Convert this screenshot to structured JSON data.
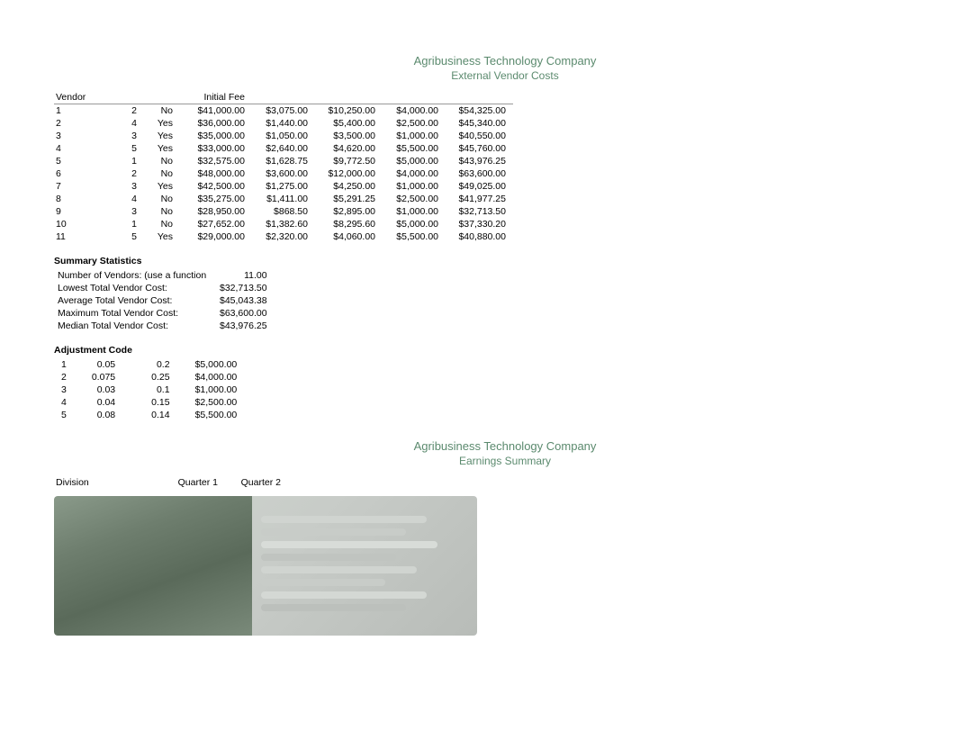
{
  "company": {
    "name": "Agribusiness Technology Company",
    "section1_title": "External Vendor Costs",
    "section2_title": "Earnings Summary"
  },
  "vendor_table": {
    "headers": [
      "Vendor",
      "",
      "",
      "Initial Fee",
      "",
      "",
      "",
      ""
    ],
    "col_headers_row2": [
      "",
      "",
      "",
      "",
      "",
      "",
      "",
      ""
    ],
    "rows": [
      {
        "vendor": "1",
        "col2": "2",
        "col3": "No",
        "initial_fee": "$41,000.00",
        "c5": "$3,075.00",
        "c6": "$10,250.00",
        "c7": "$4,000.00",
        "total": "$54,325.00"
      },
      {
        "vendor": "2",
        "col2": "4",
        "col3": "Yes",
        "initial_fee": "$36,000.00",
        "c5": "$1,440.00",
        "c6": "$5,400.00",
        "c7": "$2,500.00",
        "total": "$45,340.00"
      },
      {
        "vendor": "3",
        "col2": "3",
        "col3": "Yes",
        "initial_fee": "$35,000.00",
        "c5": "$1,050.00",
        "c6": "$3,500.00",
        "c7": "$1,000.00",
        "total": "$40,550.00"
      },
      {
        "vendor": "4",
        "col2": "5",
        "col3": "Yes",
        "initial_fee": "$33,000.00",
        "c5": "$2,640.00",
        "c6": "$4,620.00",
        "c7": "$5,500.00",
        "total": "$45,760.00"
      },
      {
        "vendor": "5",
        "col2": "1",
        "col3": "No",
        "initial_fee": "$32,575.00",
        "c5": "$1,628.75",
        "c6": "$9,772.50",
        "c7": "$5,000.00",
        "total": "$43,976.25"
      },
      {
        "vendor": "6",
        "col2": "2",
        "col3": "No",
        "initial_fee": "$48,000.00",
        "c5": "$3,600.00",
        "c6": "$12,000.00",
        "c7": "$4,000.00",
        "total": "$63,600.00"
      },
      {
        "vendor": "7",
        "col2": "3",
        "col3": "Yes",
        "initial_fee": "$42,500.00",
        "c5": "$1,275.00",
        "c6": "$4,250.00",
        "c7": "$1,000.00",
        "total": "$49,025.00"
      },
      {
        "vendor": "8",
        "col2": "4",
        "col3": "No",
        "initial_fee": "$35,275.00",
        "c5": "$1,411.00",
        "c6": "$5,291.25",
        "c7": "$2,500.00",
        "total": "$41,977.25"
      },
      {
        "vendor": "9",
        "col2": "3",
        "col3": "No",
        "initial_fee": "$28,950.00",
        "c5": "$868.50",
        "c6": "$2,895.00",
        "c7": "$1,000.00",
        "total": "$32,713.50"
      },
      {
        "vendor": "10",
        "col2": "1",
        "col3": "No",
        "initial_fee": "$27,652.00",
        "c5": "$1,382.60",
        "c6": "$8,295.60",
        "c7": "$5,000.00",
        "total": "$37,330.20"
      },
      {
        "vendor": "11",
        "col2": "5",
        "col3": "Yes",
        "initial_fee": "$29,000.00",
        "c5": "$2,320.00",
        "c6": "$4,060.00",
        "c7": "$5,500.00",
        "total": "$40,880.00"
      }
    ]
  },
  "summary_stats": {
    "title": "Summary Statistics",
    "rows": [
      {
        "label": "Number of Vendors: (use a function",
        "value": "11.00"
      },
      {
        "label": "Lowest Total Vendor Cost:",
        "value": "$32,713.50"
      },
      {
        "label": "Average Total Vendor Cost:",
        "value": "$45,043.38"
      },
      {
        "label": "Maximum Total Vendor Cost:",
        "value": "$63,600.00"
      },
      {
        "label": "Median Total Vendor Cost:",
        "value": "$43,976.25"
      }
    ]
  },
  "adjustment_table": {
    "title": "Adjustment Code",
    "rows": [
      {
        "code": "1",
        "c2": "0.05",
        "c3": "0.2",
        "amount": "$5,000.00"
      },
      {
        "code": "2",
        "c2": "0.075",
        "c3": "0.25",
        "amount": "$4,000.00"
      },
      {
        "code": "3",
        "c2": "0.03",
        "c3": "0.1",
        "amount": "$1,000.00"
      },
      {
        "code": "4",
        "c2": "0.04",
        "c3": "0.15",
        "amount": "$2,500.00"
      },
      {
        "code": "5",
        "c2": "0.08",
        "c3": "0.14",
        "amount": "$5,500.00"
      }
    ]
  },
  "earnings_table": {
    "headers": [
      "Division",
      "Quarter 1",
      "Quarter 2"
    ]
  }
}
